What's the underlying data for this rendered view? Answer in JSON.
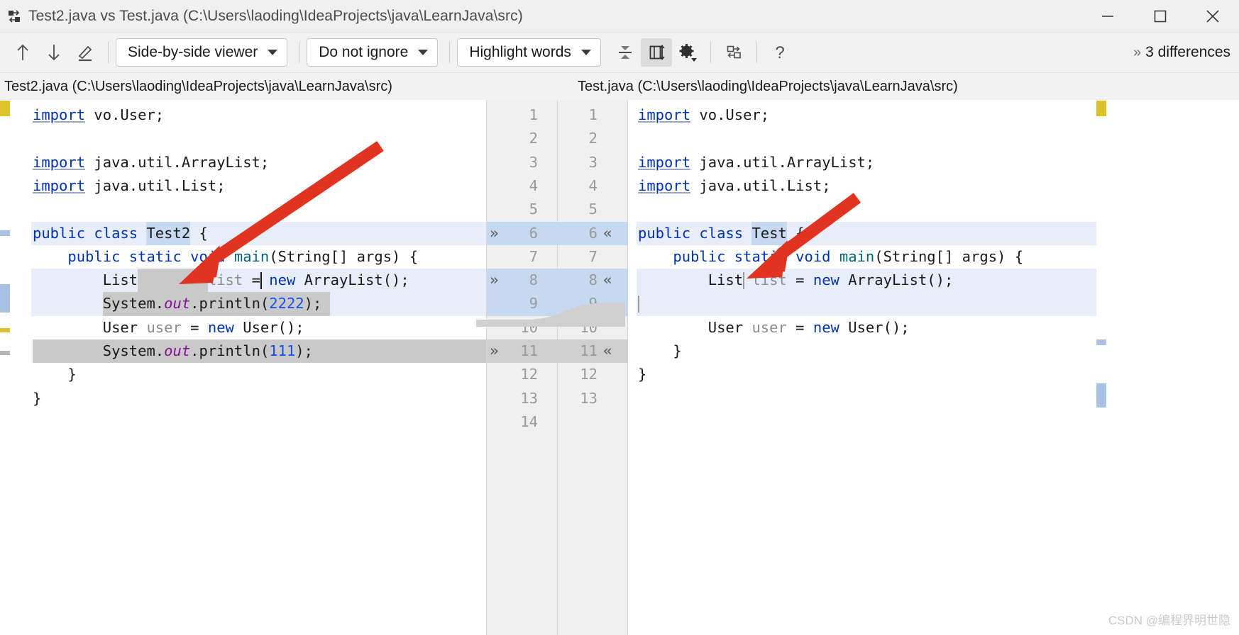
{
  "window": {
    "title": "Test2.java vs Test.java (C:\\Users\\laoding\\IdeaProjects\\java\\LearnJava\\src)",
    "app_icon": "diff-compare-icon",
    "minimize_label": "Minimize",
    "maximize_label": "Maximize",
    "close_label": "Close"
  },
  "toolbar": {
    "prev_diff_label": "Previous difference",
    "next_diff_label": "Next difference",
    "edit_label": "Edit source",
    "viewer_mode": "Side-by-side viewer",
    "ignore_mode": "Do not ignore",
    "highlight_mode": "Highlight words",
    "collapse_label": "Collapse unchanged fragments",
    "sync_scroll_label": "Synchronize scroll",
    "settings_label": "Settings",
    "swap_label": "Swap sides",
    "help_label": "Help",
    "more_label": "»",
    "differences_text": "3 differences"
  },
  "panes": {
    "left_path": "Test2.java (C:\\Users\\laoding\\IdeaProjects\\java\\LearnJava\\src)",
    "right_path": "Test.java (C:\\Users\\laoding\\IdeaProjects\\java\\LearnJava\\src)"
  },
  "gutter": {
    "rows": [
      {
        "left": "1",
        "right": "1",
        "mark_left": "",
        "mark_right": "",
        "state": ""
      },
      {
        "left": "2",
        "right": "2",
        "mark_left": "",
        "mark_right": "",
        "state": ""
      },
      {
        "left": "3",
        "right": "3",
        "mark_left": "",
        "mark_right": "",
        "state": ""
      },
      {
        "left": "4",
        "right": "4",
        "mark_left": "",
        "mark_right": "",
        "state": ""
      },
      {
        "left": "5",
        "right": "5",
        "mark_left": "",
        "mark_right": "",
        "state": ""
      },
      {
        "left": "6",
        "right": "6",
        "mark_left": "»",
        "mark_right": "«",
        "state": "b"
      },
      {
        "left": "7",
        "right": "7",
        "mark_left": "",
        "mark_right": "",
        "state": ""
      },
      {
        "left": "8",
        "right": "8",
        "mark_left": "»",
        "mark_right": "«",
        "state": "b"
      },
      {
        "left": "9",
        "right": "9",
        "mark_left": "",
        "mark_right": "",
        "state": "b"
      },
      {
        "left": "10",
        "right": "10",
        "mark_left": "",
        "mark_right": "",
        "state": ""
      },
      {
        "left": "11",
        "right": "11",
        "mark_left": "»",
        "mark_right": "«",
        "state": "g"
      },
      {
        "left": "12",
        "right": "12",
        "mark_left": "",
        "mark_right": "",
        "state": ""
      },
      {
        "left": "13",
        "right": "13",
        "mark_left": "",
        "mark_right": "",
        "state": ""
      },
      {
        "left": "14",
        "right": "",
        "mark_left": "",
        "mark_right": "",
        "state": ""
      }
    ]
  },
  "left_code": {
    "lines": [
      {
        "n": 1,
        "tokens": [
          {
            "t": "import",
            "c": "imp"
          },
          {
            "t": " vo.User;",
            "c": "pln"
          }
        ],
        "row": ""
      },
      {
        "n": 2,
        "tokens": [],
        "row": ""
      },
      {
        "n": 3,
        "tokens": [
          {
            "t": "import",
            "c": "imp"
          },
          {
            "t": " java.util.ArrayList;",
            "c": "pln"
          }
        ],
        "row": ""
      },
      {
        "n": 4,
        "tokens": [
          {
            "t": "import",
            "c": "imp"
          },
          {
            "t": " java.util.List;",
            "c": "pln"
          }
        ],
        "row": ""
      },
      {
        "n": 5,
        "tokens": [],
        "row": ""
      },
      {
        "n": 6,
        "tokens": [
          {
            "t": "public class ",
            "c": "kw"
          },
          {
            "t": "Test2",
            "c": "cls"
          },
          {
            "t": " {",
            "c": "pln"
          }
        ],
        "row": "hl-blue"
      },
      {
        "n": 7,
        "tokens": [
          {
            "t": "    public static void ",
            "c": "kw"
          },
          {
            "t": "main",
            "c": "mth"
          },
          {
            "t": "(String[] args) {",
            "c": "pln"
          }
        ],
        "row": ""
      },
      {
        "n": 8,
        "tokens": [
          {
            "t": "        List",
            "c": "pln"
          },
          {
            "t": "        ",
            "c": "pln"
          },
          {
            "t": "list",
            "c": "var"
          },
          {
            "t": " = ",
            "c": "pln"
          },
          {
            "t": "new",
            "c": "kw"
          },
          {
            "t": " ArrayList();",
            "c": "pln"
          }
        ],
        "row": "hl-blue"
      },
      {
        "n": 9,
        "tokens": [
          {
            "t": "        System.",
            "c": "pln"
          },
          {
            "t": "out",
            "c": "fld"
          },
          {
            "t": ".println(",
            "c": "pln"
          },
          {
            "t": "2222",
            "c": "num"
          },
          {
            "t": ");",
            "c": "pln"
          }
        ],
        "row": "hl-blue"
      },
      {
        "n": 10,
        "tokens": [
          {
            "t": "        User ",
            "c": "pln"
          },
          {
            "t": "user",
            "c": "var"
          },
          {
            "t": " = ",
            "c": "pln"
          },
          {
            "t": "new",
            "c": "kw"
          },
          {
            "t": " User();",
            "c": "pln"
          }
        ],
        "row": ""
      },
      {
        "n": 11,
        "tokens": [
          {
            "t": "        System.",
            "c": "pln"
          },
          {
            "t": "out",
            "c": "fld"
          },
          {
            "t": ".println(",
            "c": "pln"
          },
          {
            "t": "111",
            "c": "num"
          },
          {
            "t": ");",
            "c": "pln"
          }
        ],
        "row": ""
      },
      {
        "n": 12,
        "tokens": [
          {
            "t": "    }",
            "c": "pln"
          }
        ],
        "row": ""
      },
      {
        "n": 13,
        "tokens": [
          {
            "t": "}",
            "c": "pln"
          }
        ],
        "row": ""
      }
    ]
  },
  "right_code": {
    "lines": [
      {
        "n": 1,
        "tokens": [
          {
            "t": "import",
            "c": "imp"
          },
          {
            "t": " vo.User;",
            "c": "pln"
          }
        ],
        "row": ""
      },
      {
        "n": 2,
        "tokens": [],
        "row": ""
      },
      {
        "n": 3,
        "tokens": [
          {
            "t": "import",
            "c": "imp"
          },
          {
            "t": " java.util.ArrayList;",
            "c": "pln"
          }
        ],
        "row": ""
      },
      {
        "n": 4,
        "tokens": [
          {
            "t": "import",
            "c": "imp"
          },
          {
            "t": " java.util.List;",
            "c": "pln"
          }
        ],
        "row": ""
      },
      {
        "n": 5,
        "tokens": [],
        "row": ""
      },
      {
        "n": 6,
        "tokens": [
          {
            "t": "public class ",
            "c": "kw"
          },
          {
            "t": "Test",
            "c": "cls"
          },
          {
            "t": " {",
            "c": "pln"
          }
        ],
        "row": "hl-blue"
      },
      {
        "n": 7,
        "tokens": [
          {
            "t": "    public static void ",
            "c": "kw"
          },
          {
            "t": "main",
            "c": "mth"
          },
          {
            "t": "(String[] args) {",
            "c": "pln"
          }
        ],
        "row": ""
      },
      {
        "n": 8,
        "tokens": [
          {
            "t": "        List",
            "c": "pln"
          },
          {
            "t": " ",
            "c": "pln"
          },
          {
            "t": "list",
            "c": "var"
          },
          {
            "t": " = ",
            "c": "pln"
          },
          {
            "t": "new",
            "c": "kw"
          },
          {
            "t": " ArrayList();",
            "c": "pln"
          }
        ],
        "row": "hl-blue"
      },
      {
        "n": 9,
        "tokens": [],
        "row": "hl-blue"
      },
      {
        "n": 10,
        "tokens": [
          {
            "t": "        User ",
            "c": "pln"
          },
          {
            "t": "user",
            "c": "var"
          },
          {
            "t": " = ",
            "c": "pln"
          },
          {
            "t": "new",
            "c": "kw"
          },
          {
            "t": " User();",
            "c": "pln"
          }
        ],
        "row": ""
      },
      {
        "n": 11,
        "tokens": [
          {
            "t": "    }",
            "c": "pln"
          }
        ],
        "row": ""
      },
      {
        "n": 12,
        "tokens": [
          {
            "t": "}",
            "c": "pln"
          }
        ],
        "row": ""
      }
    ]
  },
  "colors": {
    "diff_blue_fill": "#c7d9f0",
    "diff_blue_row": "#e8eef9",
    "diff_gray_fill": "#c9c9c9",
    "diff_gray_row": "#d4d4d4",
    "marker_yellow": "#ddc32b",
    "marker_blue": "#a8c2e3",
    "marker_gray": "#b6b6b6",
    "keyword": "#0033b3",
    "number": "#1750eb",
    "field": "#871094",
    "method": "#00627a",
    "arrow_red": "#e03420"
  },
  "watermark": "CSDN @编程界明世隐"
}
